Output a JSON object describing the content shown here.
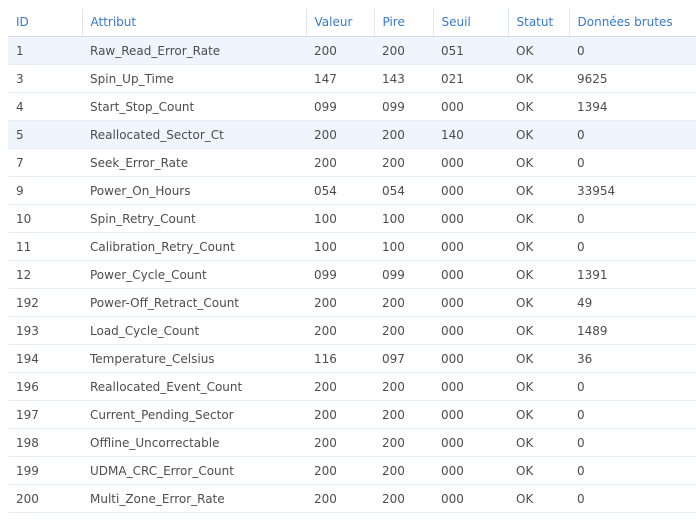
{
  "table": {
    "headers": {
      "id": "ID",
      "attribute": "Attribut",
      "value": "Valeur",
      "worst": "Pire",
      "threshold": "Seuil",
      "status": "Statut",
      "raw": "Données brutes"
    },
    "selected_row_index": 0,
    "highlighted_row_indices": [
      0,
      3
    ],
    "rows": [
      {
        "id": "1",
        "attribute": "Raw_Read_Error_Rate",
        "value": "200",
        "worst": "200",
        "threshold": "051",
        "status": "OK",
        "raw": "0"
      },
      {
        "id": "3",
        "attribute": "Spin_Up_Time",
        "value": "147",
        "worst": "143",
        "threshold": "021",
        "status": "OK",
        "raw": "9625"
      },
      {
        "id": "4",
        "attribute": "Start_Stop_Count",
        "value": "099",
        "worst": "099",
        "threshold": "000",
        "status": "OK",
        "raw": "1394"
      },
      {
        "id": "5",
        "attribute": "Reallocated_Sector_Ct",
        "value": "200",
        "worst": "200",
        "threshold": "140",
        "status": "OK",
        "raw": "0"
      },
      {
        "id": "7",
        "attribute": "Seek_Error_Rate",
        "value": "200",
        "worst": "200",
        "threshold": "000",
        "status": "OK",
        "raw": "0"
      },
      {
        "id": "9",
        "attribute": "Power_On_Hours",
        "value": "054",
        "worst": "054",
        "threshold": "000",
        "status": "OK",
        "raw": "33954"
      },
      {
        "id": "10",
        "attribute": "Spin_Retry_Count",
        "value": "100",
        "worst": "100",
        "threshold": "000",
        "status": "OK",
        "raw": "0"
      },
      {
        "id": "11",
        "attribute": "Calibration_Retry_Count",
        "value": "100",
        "worst": "100",
        "threshold": "000",
        "status": "OK",
        "raw": "0"
      },
      {
        "id": "12",
        "attribute": "Power_Cycle_Count",
        "value": "099",
        "worst": "099",
        "threshold": "000",
        "status": "OK",
        "raw": "1391"
      },
      {
        "id": "192",
        "attribute": "Power-Off_Retract_Count",
        "value": "200",
        "worst": "200",
        "threshold": "000",
        "status": "OK",
        "raw": "49"
      },
      {
        "id": "193",
        "attribute": "Load_Cycle_Count",
        "value": "200",
        "worst": "200",
        "threshold": "000",
        "status": "OK",
        "raw": "1489"
      },
      {
        "id": "194",
        "attribute": "Temperature_Celsius",
        "value": "116",
        "worst": "097",
        "threshold": "000",
        "status": "OK",
        "raw": "36"
      },
      {
        "id": "196",
        "attribute": "Reallocated_Event_Count",
        "value": "200",
        "worst": "200",
        "threshold": "000",
        "status": "OK",
        "raw": "0"
      },
      {
        "id": "197",
        "attribute": "Current_Pending_Sector",
        "value": "200",
        "worst": "200",
        "threshold": "000",
        "status": "OK",
        "raw": "0"
      },
      {
        "id": "198",
        "attribute": "Offline_Uncorrectable",
        "value": "200",
        "worst": "200",
        "threshold": "000",
        "status": "OK",
        "raw": "0"
      },
      {
        "id": "199",
        "attribute": "UDMA_CRC_Error_Count",
        "value": "200",
        "worst": "200",
        "threshold": "000",
        "status": "OK",
        "raw": "0"
      },
      {
        "id": "200",
        "attribute": "Multi_Zone_Error_Rate",
        "value": "200",
        "worst": "200",
        "threshold": "000",
        "status": "OK",
        "raw": "0"
      }
    ]
  },
  "colors": {
    "header_text": "#3a7ac8",
    "body_text": "#4d4d4d",
    "selected_row_bg": "#eef5fc"
  }
}
